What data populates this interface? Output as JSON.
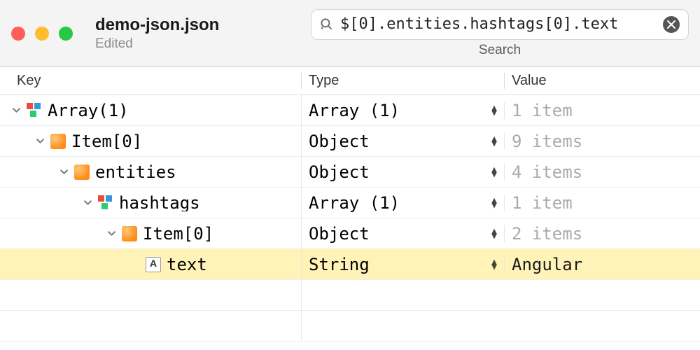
{
  "window": {
    "title": "demo-json.json",
    "subtitle": "Edited"
  },
  "search": {
    "value": "$[0].entities.hashtags[0].text",
    "label": "Search"
  },
  "columns": {
    "key": "Key",
    "type": "Type",
    "value": "Value"
  },
  "rows": [
    {
      "key": "Array(1)",
      "type": "Array (1)",
      "value": "1 item",
      "indent": 0,
      "icon": "array",
      "expanded": true,
      "highlighted": false,
      "value_strong": false
    },
    {
      "key": "Item[0]",
      "type": "Object",
      "value": "9 items",
      "indent": 1,
      "icon": "object",
      "expanded": true,
      "highlighted": false,
      "value_strong": false
    },
    {
      "key": "entities",
      "type": "Object",
      "value": "4 items",
      "indent": 2,
      "icon": "object",
      "expanded": true,
      "highlighted": false,
      "value_strong": false
    },
    {
      "key": "hashtags",
      "type": "Array (1)",
      "value": "1 item",
      "indent": 3,
      "icon": "array",
      "expanded": true,
      "highlighted": false,
      "value_strong": false
    },
    {
      "key": "Item[0]",
      "type": "Object",
      "value": "2 items",
      "indent": 4,
      "icon": "object",
      "expanded": true,
      "highlighted": false,
      "value_strong": false
    },
    {
      "key": "text",
      "type": "String",
      "value": "Angular",
      "indent": 5,
      "icon": "string",
      "expanded": null,
      "highlighted": true,
      "value_strong": true
    }
  ]
}
